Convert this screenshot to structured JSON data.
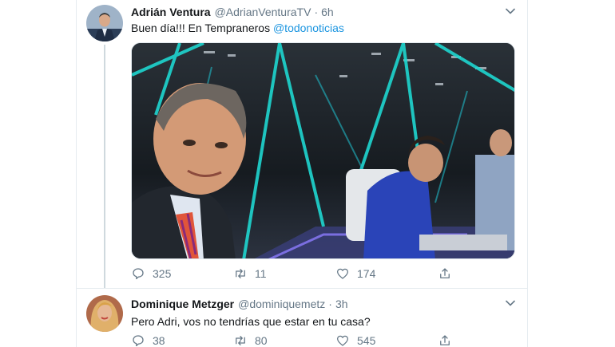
{
  "colors": {
    "link": "#1b95e0",
    "secondary_text": "#657786",
    "primary_text": "#14171a",
    "divider": "#e6ecf0"
  },
  "tweets": [
    {
      "display_name": "Adrián Ventura",
      "handle": "@AdrianVenturaTV",
      "separator": "·",
      "time": "6h",
      "text_before": "Buen día!!! En Tempraneros ",
      "mention": "@todonoticias",
      "avatar_icon": "avatar-photo",
      "media_icon": "tv-studio-photo",
      "reply_count": "325",
      "retweet_count": "11",
      "like_count": "174"
    },
    {
      "display_name": "Dominique Metzger",
      "handle": "@dominiquemetz",
      "separator": "·",
      "time": "3h",
      "text": "Pero Adri, vos no tendrías que estar en tu casa?",
      "avatar_icon": "avatar-photo",
      "reply_count": "38",
      "retweet_count": "80",
      "like_count": "545"
    }
  ]
}
